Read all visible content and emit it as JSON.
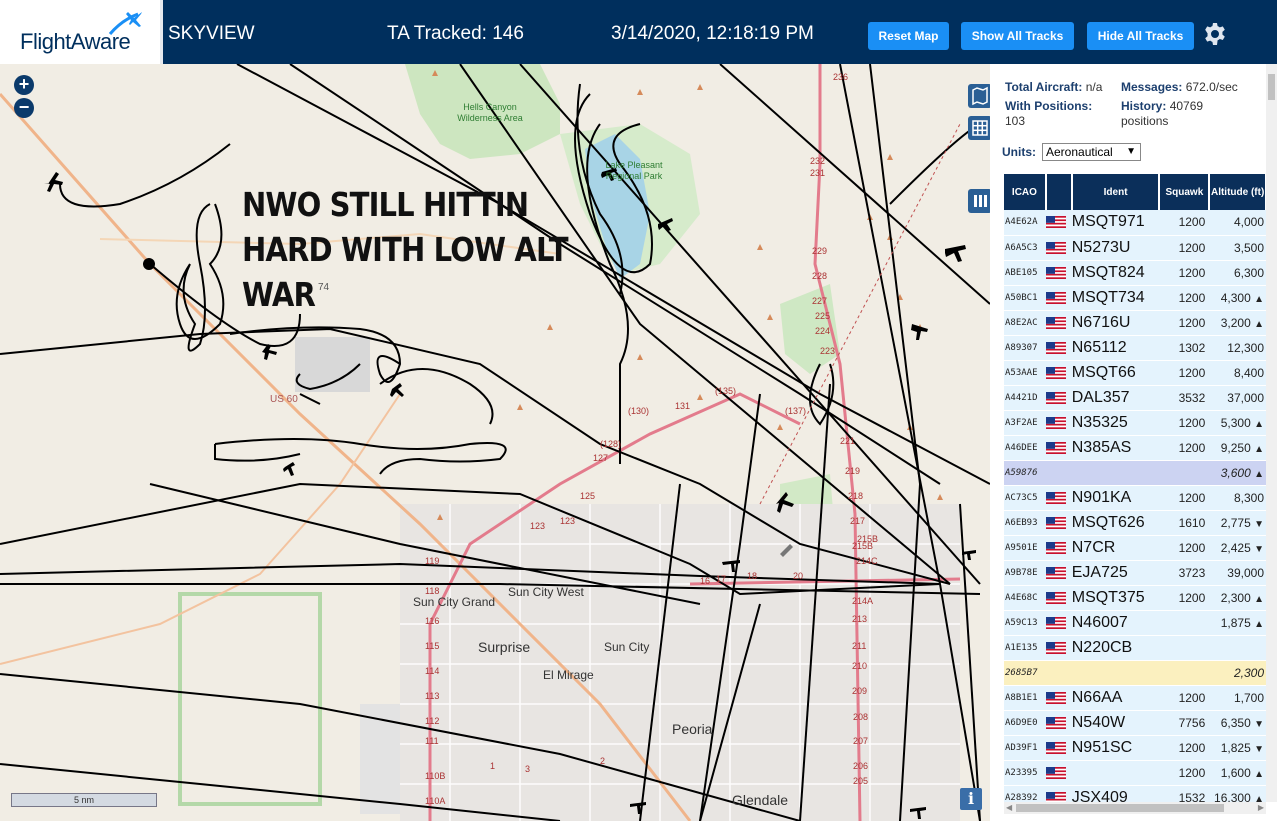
{
  "header": {
    "logo_text": "FlightAware",
    "app_title": "SKYVIEW",
    "ta_tracked": "TA Tracked: 146",
    "clock": "3/14/2020, 12:18:19 PM",
    "reset_label": "Reset Map",
    "show_label": "Show All Tracks",
    "hide_label": "Hide All Tracks",
    "settings_icon": "gear-icon"
  },
  "map": {
    "overlay_lines": [
      "NWO STILL HITTIN",
      "HARD WITH LOW ALT",
      "WAR"
    ],
    "zoom_in": "+",
    "zoom_out": "−",
    "scale": "5 nm",
    "info": "i",
    "labels": {
      "hells_canyon": "Hells Canyon Wilderness Area",
      "lake_pleasant": "Lake Pleasant Regional Park",
      "sun_city_grand": "Sun City Grand",
      "sun_city_west": "Sun City West",
      "surprise": "Surprise",
      "sun_city": "Sun City",
      "el_mirage": "El Mirage",
      "peoria": "Peoria",
      "glendale": "Glendale",
      "us60": "US 60",
      "r74": "74"
    }
  },
  "stats": {
    "total_aircraft_label": "Total Aircraft:",
    "total_aircraft_value": "n/a",
    "messages_label": "Messages:",
    "messages_value": "672.0/sec",
    "with_positions_label": "With Positions:",
    "with_positions_value": "103",
    "history_label": "History:",
    "history_value": "40769 positions",
    "units_label": "Units:",
    "units_value": "Aeronautical"
  },
  "table": {
    "columns": [
      "ICAO",
      "",
      "Ident",
      "Squawk",
      "Altitude (ft)"
    ],
    "rows": [
      {
        "icao": "A4E62A",
        "flag": true,
        "ident": "MSQT971",
        "squawk": "1200",
        "alt": "4,000",
        "trend": "",
        "style": ""
      },
      {
        "icao": "A6A5C3",
        "flag": true,
        "ident": "N5273U",
        "squawk": "1200",
        "alt": "3,500",
        "trend": "",
        "style": ""
      },
      {
        "icao": "ABE105",
        "flag": true,
        "ident": "MSQT824",
        "squawk": "1200",
        "alt": "6,300",
        "trend": "",
        "style": ""
      },
      {
        "icao": "A50BC1",
        "flag": true,
        "ident": "MSQT734",
        "squawk": "1200",
        "alt": "4,300",
        "trend": "▲",
        "style": ""
      },
      {
        "icao": "A8E2AC",
        "flag": true,
        "ident": "N6716U",
        "squawk": "1200",
        "alt": "3,200",
        "trend": "▲",
        "style": ""
      },
      {
        "icao": "A89307",
        "flag": true,
        "ident": "N65112",
        "squawk": "1302",
        "alt": "12,300",
        "trend": "",
        "style": ""
      },
      {
        "icao": "A53AAE",
        "flag": true,
        "ident": "MSQT66",
        "squawk": "1200",
        "alt": "8,400",
        "trend": "",
        "style": ""
      },
      {
        "icao": "A4421D",
        "flag": true,
        "ident": "DAL357",
        "squawk": "3532",
        "alt": "37,000",
        "trend": "",
        "style": ""
      },
      {
        "icao": "A3F2AE",
        "flag": true,
        "ident": "N35325",
        "squawk": "1200",
        "alt": "5,300",
        "trend": "▲",
        "style": ""
      },
      {
        "icao": "A46DEE",
        "flag": true,
        "ident": "N385AS",
        "squawk": "1200",
        "alt": "9,250",
        "trend": "▲",
        "style": ""
      },
      {
        "icao": "A59876",
        "flag": false,
        "ident": "",
        "squawk": "",
        "alt": "3,600",
        "trend": "▲",
        "style": "sel"
      },
      {
        "icao": "AC73C5",
        "flag": true,
        "ident": "N901KA",
        "squawk": "1200",
        "alt": "8,300",
        "trend": "",
        "style": ""
      },
      {
        "icao": "A6EB93",
        "flag": true,
        "ident": "MSQT626",
        "squawk": "1610",
        "alt": "2,775",
        "trend": "▼",
        "style": ""
      },
      {
        "icao": "A9501E",
        "flag": true,
        "ident": "N7CR",
        "squawk": "1200",
        "alt": "2,425",
        "trend": "▼",
        "style": ""
      },
      {
        "icao": "A9B78E",
        "flag": true,
        "ident": "EJA725",
        "squawk": "3723",
        "alt": "39,000",
        "trend": "",
        "style": ""
      },
      {
        "icao": "A4E68C",
        "flag": true,
        "ident": "MSQT375",
        "squawk": "1200",
        "alt": "2,300",
        "trend": "▲",
        "style": ""
      },
      {
        "icao": "A59C13",
        "flag": true,
        "ident": "N46007",
        "squawk": "",
        "alt": "1,875",
        "trend": "▲",
        "style": ""
      },
      {
        "icao": "A1E135",
        "flag": true,
        "ident": "N220CB",
        "squawk": "",
        "alt": "",
        "trend": "",
        "style": ""
      },
      {
        "icao": "2685B7",
        "flag": false,
        "ident": "",
        "squawk": "",
        "alt": "2,300",
        "trend": "",
        "style": "nodata"
      },
      {
        "icao": "A8B1E1",
        "flag": true,
        "ident": "N66AA",
        "squawk": "1200",
        "alt": "1,700",
        "trend": "",
        "style": ""
      },
      {
        "icao": "A6D9E0",
        "flag": true,
        "ident": "N540W",
        "squawk": "7756",
        "alt": "6,350",
        "trend": "▼",
        "style": ""
      },
      {
        "icao": "AD39F1",
        "flag": true,
        "ident": "N951SC",
        "squawk": "1200",
        "alt": "1,825",
        "trend": "▼",
        "style": ""
      },
      {
        "icao": "A23395",
        "flag": true,
        "ident": "",
        "squawk": "1200",
        "alt": "1,600",
        "trend": "▲",
        "style": ""
      },
      {
        "icao": "A28392",
        "flag": true,
        "ident": "JSX409",
        "squawk": "1532",
        "alt": "16,300",
        "trend": "▲",
        "style": ""
      }
    ]
  },
  "colors": {
    "header_bg": "#002f5d",
    "button_blue": "#1a8ff5",
    "table_head": "#0b2f5a",
    "row_bg": "#e4f3fd",
    "row_selected": "#ccd3f2",
    "row_nodata": "#fbf0bf"
  }
}
